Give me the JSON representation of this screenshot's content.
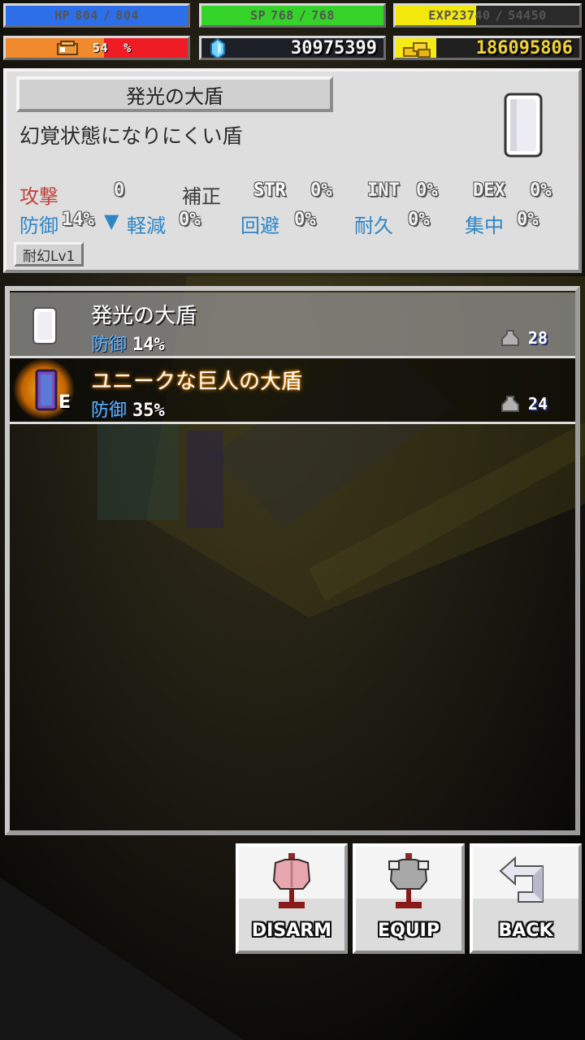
{
  "status": {
    "hp": {
      "label": "HP",
      "current": "804",
      "max": "804",
      "fraction": 1.0,
      "color": "#2d6fe8"
    },
    "sp": {
      "label": "SP",
      "current": "768",
      "max": "768",
      "fraction": 1.0,
      "color": "#35d22a"
    },
    "exp": {
      "label": "EXP",
      "current": "23740",
      "max": "54450",
      "fraction": 0.436,
      "color": "#f2e80c"
    },
    "hunger": {
      "value": "54",
      "unit": "%",
      "fraction": 0.54,
      "color_fill": "#f08a2c",
      "color_empty": "#ee1c25"
    },
    "crystals": "30975399",
    "gold": "186095806",
    "separator": "/"
  },
  "item_detail": {
    "name": "発光の大盾",
    "description": "幻覚状態になりにくい盾",
    "attack_label": "攻撃",
    "attack_value": "0",
    "bonus_label": "補正",
    "str_label": "STR",
    "str_value": "0%",
    "int_label": "INT",
    "int_value": "0%",
    "dex_label": "DEX",
    "dex_value": "0%",
    "defense_label": "防御",
    "defense_value": "14%",
    "defense_trend": "▼",
    "reduce_label": "軽減",
    "reduce_value": "0%",
    "evade_label": "回避",
    "evade_value": "0%",
    "durability_label": "耐久",
    "durability_value": "0%",
    "focus_label": "集中",
    "focus_value": "0%",
    "badge": "耐幻Lv1"
  },
  "items": [
    {
      "name": "発光の大盾",
      "stat_label": "防御",
      "stat_value": "14%",
      "weight": "28",
      "selected": true,
      "equipped": false
    },
    {
      "name": "ユニークな巨人の大盾",
      "stat_label": "防御",
      "stat_value": "35%",
      "weight": "24",
      "selected": false,
      "equipped": true,
      "equipped_mark": "E"
    }
  ],
  "buttons": {
    "disarm": "DISARM",
    "equip": "EQUIP",
    "back": "BACK"
  }
}
